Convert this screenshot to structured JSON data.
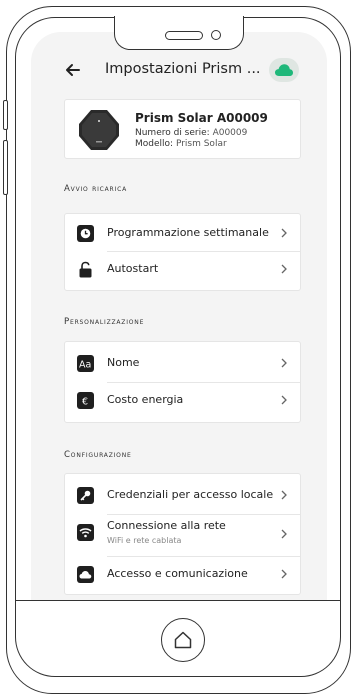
{
  "header": {
    "title": "Impostazioni Prism ...",
    "back_icon": "arrow-left-icon",
    "cloud_icon": "cloud-icon",
    "cloud_color": "#1fb87a"
  },
  "device": {
    "name": "Prism Solar A00009",
    "serial_label": "Numero di serie:",
    "serial_value": "A00009",
    "model_label": "Modello:",
    "model_value": "Prism Solar"
  },
  "sections": [
    {
      "title": "Avvio ricarica",
      "items": [
        {
          "label": "Programmazione settimanale",
          "icon": "clock-icon"
        },
        {
          "label": "Autostart",
          "icon": "unlock-icon"
        }
      ]
    },
    {
      "title": "Personalizzazione",
      "items": [
        {
          "label": "Nome",
          "icon": "text-aa-icon"
        },
        {
          "label": "Costo energia",
          "icon": "euro-icon"
        }
      ]
    },
    {
      "title": "Configurazione",
      "items": [
        {
          "label": "Credenziali per accesso locale",
          "icon": "key-icon"
        },
        {
          "label": "Connessione alla rete",
          "sublabel": "WiFi e rete cablata",
          "icon": "wifi-icon"
        },
        {
          "label": "Accesso e comunicazione",
          "icon": "cloud-icon"
        }
      ]
    }
  ]
}
